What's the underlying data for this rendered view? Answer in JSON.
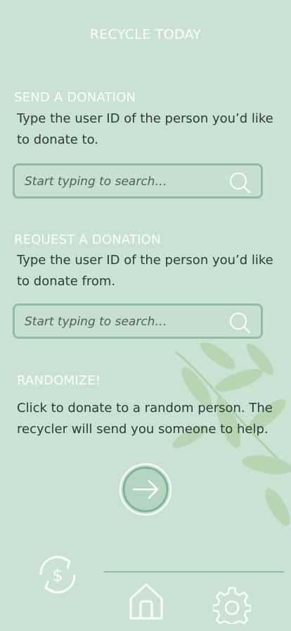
{
  "header": {
    "title": "RECYCLE TODAY"
  },
  "send": {
    "heading": "SEND A DONATION",
    "description": "Type the user ID of the person you’d like to donate to.",
    "search_placeholder": "Start typing to search…"
  },
  "request": {
    "heading": "REQUEST A DONATION",
    "description": "Type the user ID of the person you’d like to donate from.",
    "search_placeholder": "Start typing to search…"
  },
  "randomize": {
    "heading": "RANDOMIZE!",
    "description": "Click to donate to a random person. The recycler will send you someone to help."
  },
  "icons": {
    "search": "search-icon",
    "go": "arrow-right-circle-icon",
    "recycle_money": "recycle-dollar-icon",
    "home": "home-icon",
    "settings": "gear-icon"
  },
  "colors": {
    "background": "#c9e2d4",
    "accent": "#8cbf9f",
    "heading_text": "#ffffff",
    "body_text": "#2f3a34"
  }
}
